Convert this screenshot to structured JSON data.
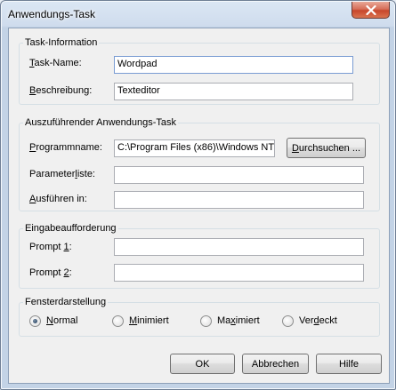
{
  "window": {
    "title": "Anwendungs-Task"
  },
  "task_info": {
    "legend": "Task-Information",
    "name_label_u": "T",
    "name_label_rest": "ask-Name:",
    "name_value": "Wordpad",
    "desc_label_u": "B",
    "desc_label_rest": "eschreibung:",
    "desc_value": "Texteditor"
  },
  "app_task": {
    "legend": "Auszuführender Anwendungs-Task",
    "program_label_u": "P",
    "program_label_rest": "rogrammname:",
    "program_value": "C:\\Program Files (x86)\\Windows NT\\",
    "browse_label_u": "D",
    "browse_label_rest": "urchsuchen ...",
    "params_label_pre": "Parameter",
    "params_label_u": "l",
    "params_label_rest": "iste:",
    "params_value": "",
    "run_in_label_u": "A",
    "run_in_label_rest": "usführen in:",
    "run_in_value": ""
  },
  "prompts": {
    "legend": "Eingabeaufforderung",
    "prompt1_label_pre": "Prompt ",
    "prompt1_label_u": "1",
    "prompt1_label_rest": ":",
    "prompt1_value": "",
    "prompt2_label_pre": "Prompt ",
    "prompt2_label_u": "2",
    "prompt2_label_rest": ":",
    "prompt2_value": ""
  },
  "window_mode": {
    "legend": "Fensterdarstellung",
    "selected": "Normal",
    "options": [
      {
        "u": "N",
        "rest": "ormal"
      },
      {
        "u": "M",
        "rest": "inimiert"
      },
      {
        "pre": "Ma",
        "u": "x",
        "rest": "imiert"
      },
      {
        "pre": "Ver",
        "u": "d",
        "rest": "eckt"
      }
    ]
  },
  "buttons": {
    "ok": "OK",
    "cancel": "Abbrechen",
    "help": "Hilfe"
  },
  "icons": {
    "close": "close-icon"
  }
}
